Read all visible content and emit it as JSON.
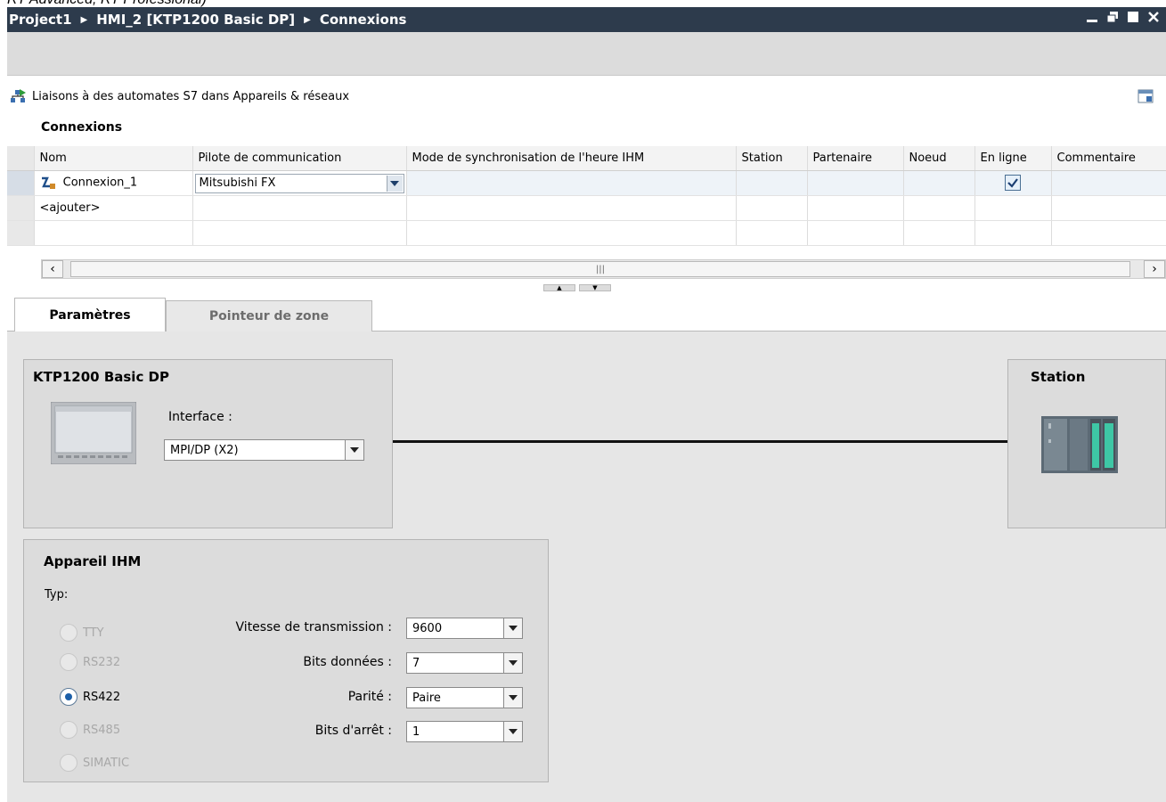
{
  "caption": "RT Advanced, RT Professional)",
  "breadcrumb": {
    "project": "Project1",
    "device": "HMI_2 [KTP1200 Basic DP]",
    "editor": "Connexions"
  },
  "window_controls": [
    "minimize-icon",
    "restore-icon",
    "maximize-icon",
    "close-icon"
  ],
  "link_bar": {
    "text": "Liaisons à des automates S7 dans Appareils & réseaux"
  },
  "section_title": "Connexions",
  "grid": {
    "headers": [
      "Nom",
      "Pilote de communication",
      "Mode de synchronisation de l'heure IHM",
      "Station",
      "Partenaire",
      "Noeud",
      "En ligne",
      "Commentaire"
    ],
    "rows": [
      {
        "name": "Connexion_1",
        "driver": "Mitsubishi FX",
        "online": true
      },
      {
        "name": "<ajouter>"
      }
    ]
  },
  "tabs": [
    {
      "label": "Paramètres",
      "active": true
    },
    {
      "label": "Pointeur de zone",
      "active": false
    }
  ],
  "hmi_device": {
    "title": "KTP1200 Basic DP",
    "interface_label": "Interface :",
    "interface_value": "MPI/DP (X2)"
  },
  "station": {
    "title": "Station"
  },
  "appareil_ihm": {
    "title": "Appareil IHM",
    "type_label": "Typ:",
    "types": [
      {
        "label": "TTY",
        "selected": false,
        "enabled": false
      },
      {
        "label": "RS232",
        "selected": false,
        "enabled": false
      },
      {
        "label": "RS422",
        "selected": true,
        "enabled": true
      },
      {
        "label": "RS485",
        "selected": false,
        "enabled": false
      },
      {
        "label": "SIMATIC",
        "selected": false,
        "enabled": false
      }
    ],
    "params": [
      {
        "label": "Vitesse de transmission :",
        "value": "9600"
      },
      {
        "label": "Bits données :",
        "value": "7"
      },
      {
        "label": "Parité :",
        "value": "Paire"
      },
      {
        "label": "Bits d'arrêt :",
        "value": "1"
      }
    ]
  },
  "colors": {
    "titlebar": "#2d3b4c",
    "accent": "#1c5fa8",
    "panel": "#dcdcdc"
  }
}
